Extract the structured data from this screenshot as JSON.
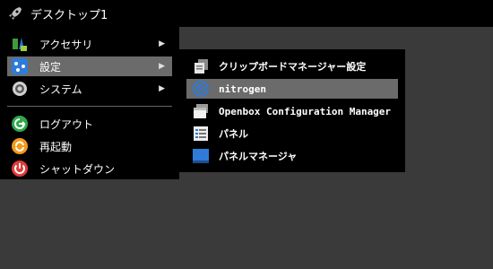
{
  "desktop_title": "デスクトップ1",
  "main_menu": [
    {
      "label": "アクセサリ",
      "has_submenu": true
    },
    {
      "label": "設定",
      "has_submenu": true
    },
    {
      "label": "システム",
      "has_submenu": true
    },
    {
      "label": "ログアウト",
      "has_submenu": false
    },
    {
      "label": "再起動",
      "has_submenu": false
    },
    {
      "label": "シャットダウン",
      "has_submenu": false
    }
  ],
  "submenu": [
    {
      "label": "クリップボードマネージャー設定"
    },
    {
      "label": "nitrogen"
    },
    {
      "label": "Openbox Configuration Manager"
    },
    {
      "label": "パネル"
    },
    {
      "label": "パネルマネージャ"
    }
  ],
  "arrow_glyph": "▶",
  "colors": {
    "background": "#3a3a3a",
    "menu_bg": "#000000",
    "highlight": "#6b6b6b",
    "logout": "#2ea84c",
    "reboot": "#f39a1b",
    "shutdown": "#e13a3a",
    "blue": "#2f7bd8"
  }
}
